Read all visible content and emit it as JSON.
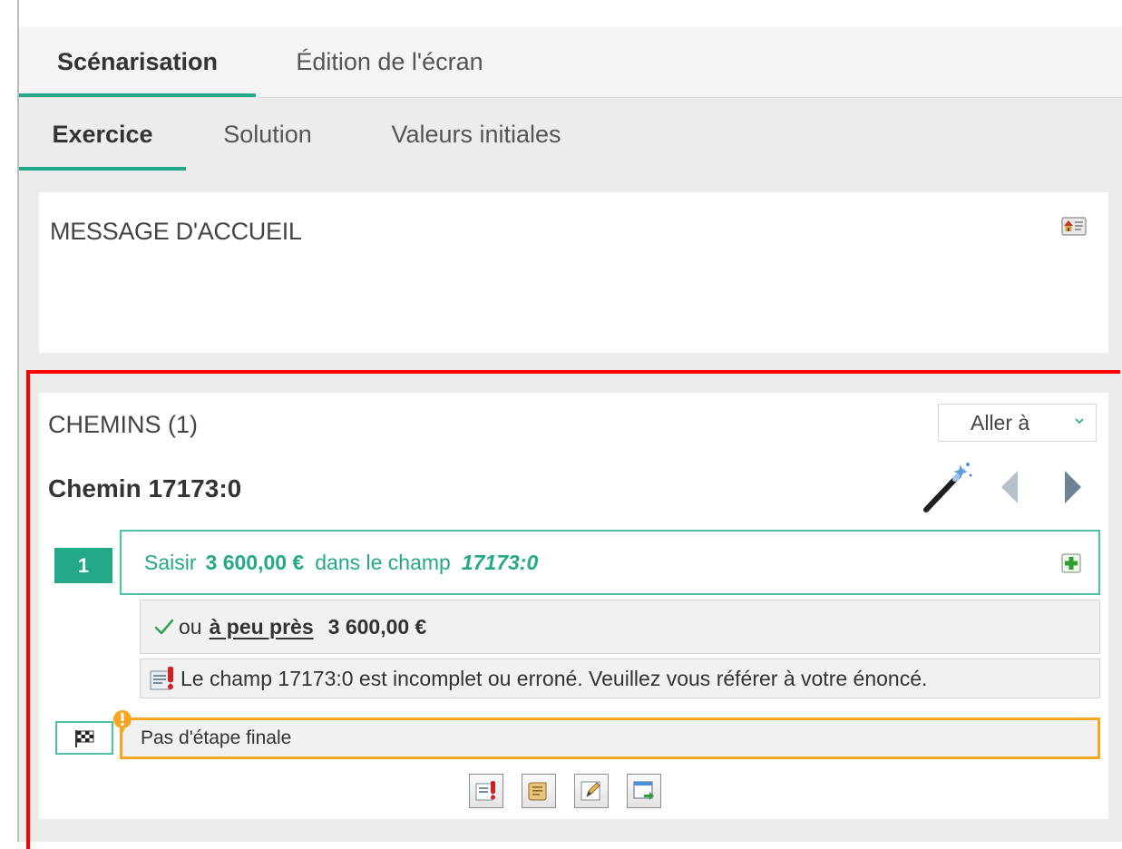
{
  "tabs_primary": [
    {
      "label": "Scénarisation",
      "active": true
    },
    {
      "label": "Édition de l'écran",
      "active": false
    }
  ],
  "tabs_secondary": [
    {
      "label": "Exercice",
      "active": true
    },
    {
      "label": "Solution",
      "active": false
    },
    {
      "label": "Valeurs initiales",
      "active": false
    }
  ],
  "welcome": {
    "title": "MESSAGE D'ACCUEIL",
    "icon": "home-card-icon"
  },
  "paths": {
    "title": "CHEMINS (1)",
    "goto_label": "Aller à",
    "path_name": "Chemin 17173:0",
    "step": {
      "number": "1",
      "verb": "Saisir",
      "value": "3 600,00 €",
      "connector": "dans le champ",
      "field": "17173:0"
    },
    "tolerance": {
      "prefix": "ou",
      "mode": "à peu près",
      "amount": "3 600,00 €"
    },
    "error_message": "Le champ 17173:0 est incomplet ou erroné. Veuillez vous référer à votre énoncé.",
    "final_step": "Pas d'étape finale",
    "toolbar_icons": [
      "error-message-icon",
      "scroll-icon",
      "edit-note-icon",
      "window-export-icon"
    ]
  },
  "colors": {
    "accent": "#23a98a",
    "accent_light": "#4cc0a8",
    "warning": "#f5a623",
    "highlight": "#ff0000"
  }
}
